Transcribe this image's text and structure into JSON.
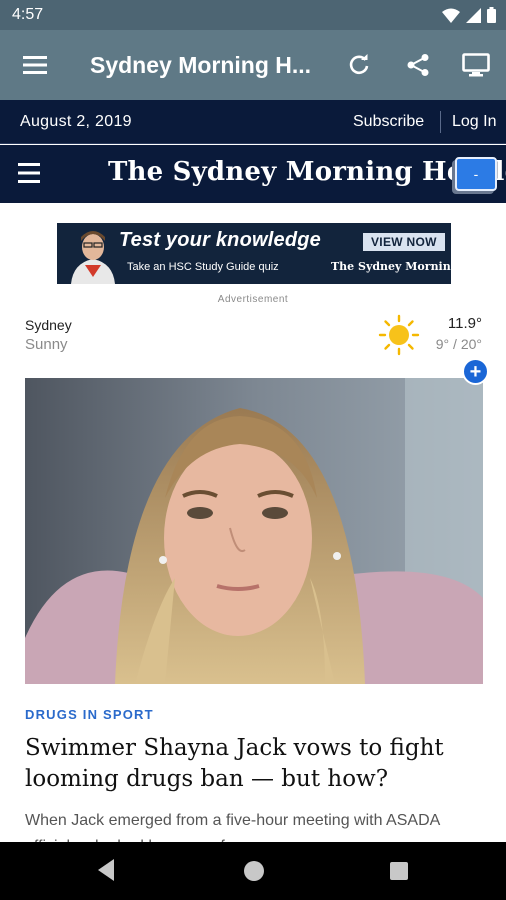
{
  "status_bar": {
    "time": "4:57",
    "icons": [
      "wifi-icon",
      "cell-signal-icon",
      "battery-icon"
    ]
  },
  "app_bar": {
    "title": "Sydney Morning H...",
    "icons": [
      "menu-icon",
      "refresh-icon",
      "share-icon",
      "cast-icon"
    ]
  },
  "date_bar": {
    "date": "August 2, 2019",
    "subscribe_label": "Subscribe",
    "login_label": "Log In"
  },
  "masthead": {
    "logo_text": "The Sydney Morning Herald",
    "button_label": "-"
  },
  "ad": {
    "headline": "Test your knowledge",
    "cta": "VIEW NOW",
    "subtext": "Take an HSC Study Guide quiz",
    "sub_logo": "The Sydney Morning Herald",
    "label": "Advertisement"
  },
  "weather": {
    "city": "Sydney",
    "condition": "Sunny",
    "temperature": "11.9°",
    "range": "9° / 20°",
    "icon": "sun-icon"
  },
  "article": {
    "category": "DRUGS IN SPORT",
    "headline": "Swimmer Shayna Jack vows to fight looming drugs ban — but how?",
    "summary": "When Jack emerged from a five-hour meeting with ASADA officials, she had her game face on."
  },
  "colors": {
    "status_bar": "#4d6573",
    "app_bar": "#5f7986",
    "masthead": "#0a1a3a",
    "accent_blue": "#2a6acb"
  }
}
